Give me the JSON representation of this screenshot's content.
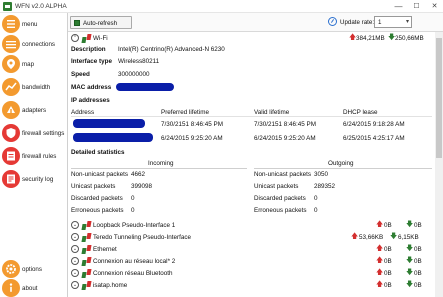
{
  "window": {
    "title": "WFN v2.0 ALPHA",
    "minimize": "—",
    "maximize": "☐",
    "close": "✕"
  },
  "sidebar": {
    "items": [
      {
        "label": "menu",
        "icon": "menu-icon"
      },
      {
        "label": "connections",
        "icon": "connections-icon"
      },
      {
        "label": "map",
        "icon": "map-icon"
      },
      {
        "label": "bandwidth",
        "icon": "bandwidth-icon"
      },
      {
        "label": "adapters",
        "icon": "adapters-icon"
      },
      {
        "label": "firewall settings",
        "icon": "firewall-settings-icon"
      },
      {
        "label": "firewall rules",
        "icon": "firewall-rules-icon"
      },
      {
        "label": "security log",
        "icon": "security-log-icon"
      },
      {
        "label": "options",
        "icon": "options-icon"
      },
      {
        "label": "about",
        "icon": "about-icon"
      }
    ]
  },
  "toolbar": {
    "auto_refresh_label": "Auto-refresh",
    "auto_refresh_checked": true,
    "update_rate_label": "Update rate:",
    "update_rate_value": "1"
  },
  "adapter": {
    "name": "Wi-Fi",
    "upload": "384,21MB",
    "download": "250,66MB",
    "fields": [
      {
        "label": "Description",
        "value": "Intel(R) Centrino(R) Advanced-N 6230"
      },
      {
        "label": "Interface type",
        "value": "Wireless80211"
      },
      {
        "label": "Speed",
        "value": "300000000"
      },
      {
        "label": "MAC address",
        "value": ""
      }
    ],
    "ip_section_title": "IP addresses",
    "ip_columns": [
      "Address",
      "Preferred lifetime",
      "Valid lifetime",
      "DHCP lease"
    ],
    "ip_rows": [
      {
        "address": "",
        "preferred": "7/30/2151 8:46:45 PM",
        "valid": "7/30/2151 8:46:45 PM",
        "dhcp": "6/24/2015 9:18:28 AM"
      },
      {
        "address": "",
        "preferred": "6/24/2015 9:25:20 AM",
        "valid": "6/24/2015 9:25:20 AM",
        "dhcp": "6/25/2015 4:25:17 AM"
      }
    ],
    "stats_title": "Detailed statistics",
    "incoming_title": "Incoming",
    "outgoing_title": "Outgoing",
    "incoming": [
      {
        "label": "Non-unicast packets",
        "value": "4662"
      },
      {
        "label": "Unicast packets",
        "value": "399098"
      },
      {
        "label": "Discarded packets",
        "value": "0"
      },
      {
        "label": "Erroneous packets",
        "value": "0"
      }
    ],
    "outgoing": [
      {
        "label": "Non-unicast packets",
        "value": "3050"
      },
      {
        "label": "Unicast packets",
        "value": "289352"
      },
      {
        "label": "Discarded packets",
        "value": "0"
      },
      {
        "label": "Erroneous packets",
        "value": "0"
      }
    ]
  },
  "other_adapters": [
    {
      "name": "Loopback Pseudo-Interface 1",
      "up": "0B",
      "down": "0B"
    },
    {
      "name": "Teredo Tunneling Pseudo-Interface",
      "up": "53,66KB",
      "down": "6,15KB"
    },
    {
      "name": "Ethernet",
      "up": "0B",
      "down": "0B"
    },
    {
      "name": "Connexion au réseau local* 2",
      "up": "0B",
      "down": "0B"
    },
    {
      "name": "Connexion réseau Bluetooth",
      "up": "0B",
      "down": "0B"
    },
    {
      "name": "isatap.home",
      "up": "0B",
      "down": "0B"
    }
  ],
  "colors": {
    "accent_orange": "#f39a2f",
    "accent_red": "#e53935",
    "up_red": "#d32f2f",
    "down_green": "#2e7d32",
    "redaction_blue": "#0a1ea8"
  }
}
